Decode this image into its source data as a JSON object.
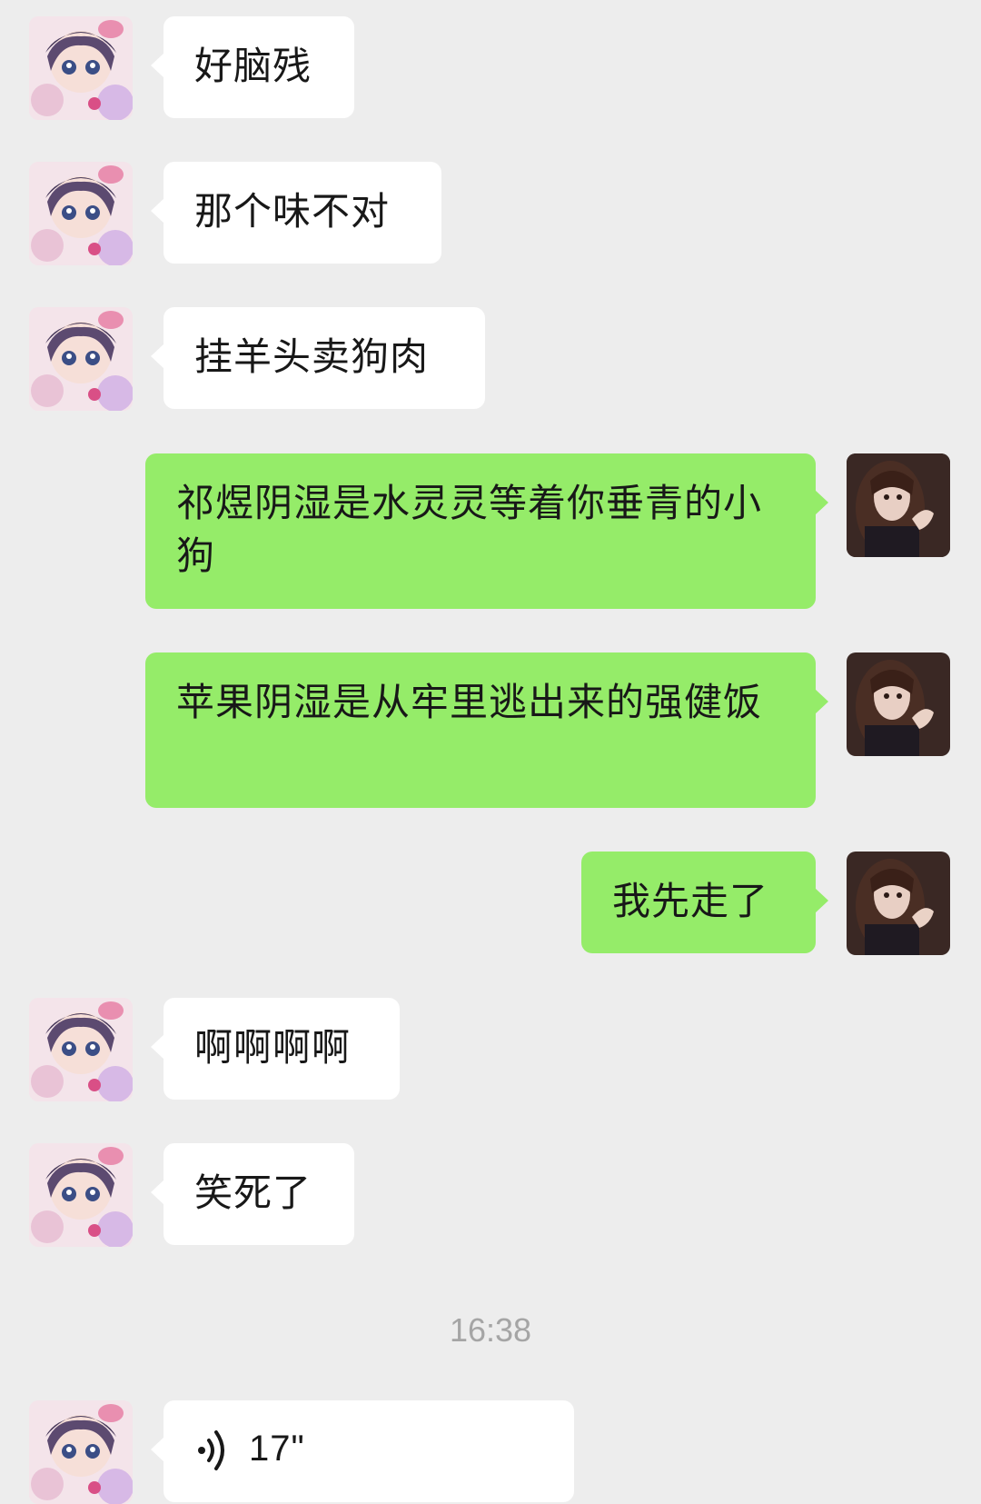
{
  "messages": [
    {
      "side": "received",
      "text": "好脑残"
    },
    {
      "side": "received",
      "text": "那个味不对"
    },
    {
      "side": "received",
      "text": "挂羊头卖狗肉"
    },
    {
      "side": "sent",
      "text": "祁煜阴湿是水灵灵等着你垂青的小狗"
    },
    {
      "side": "sent",
      "text": "苹果阴湿是从牢里逃出来的强健饭"
    },
    {
      "side": "sent",
      "text": "我先走了"
    },
    {
      "side": "received",
      "text": "啊啊啊啊"
    },
    {
      "side": "received",
      "text": "笑死了"
    }
  ],
  "timestamp": "16:38",
  "voice_message": {
    "side": "received",
    "duration": "17\"",
    "icon": "voice-wave-icon"
  },
  "colors": {
    "background": "#ededed",
    "sent_bubble": "#95ec69",
    "received_bubble": "#ffffff",
    "timestamp_text": "#a5a5a5"
  }
}
